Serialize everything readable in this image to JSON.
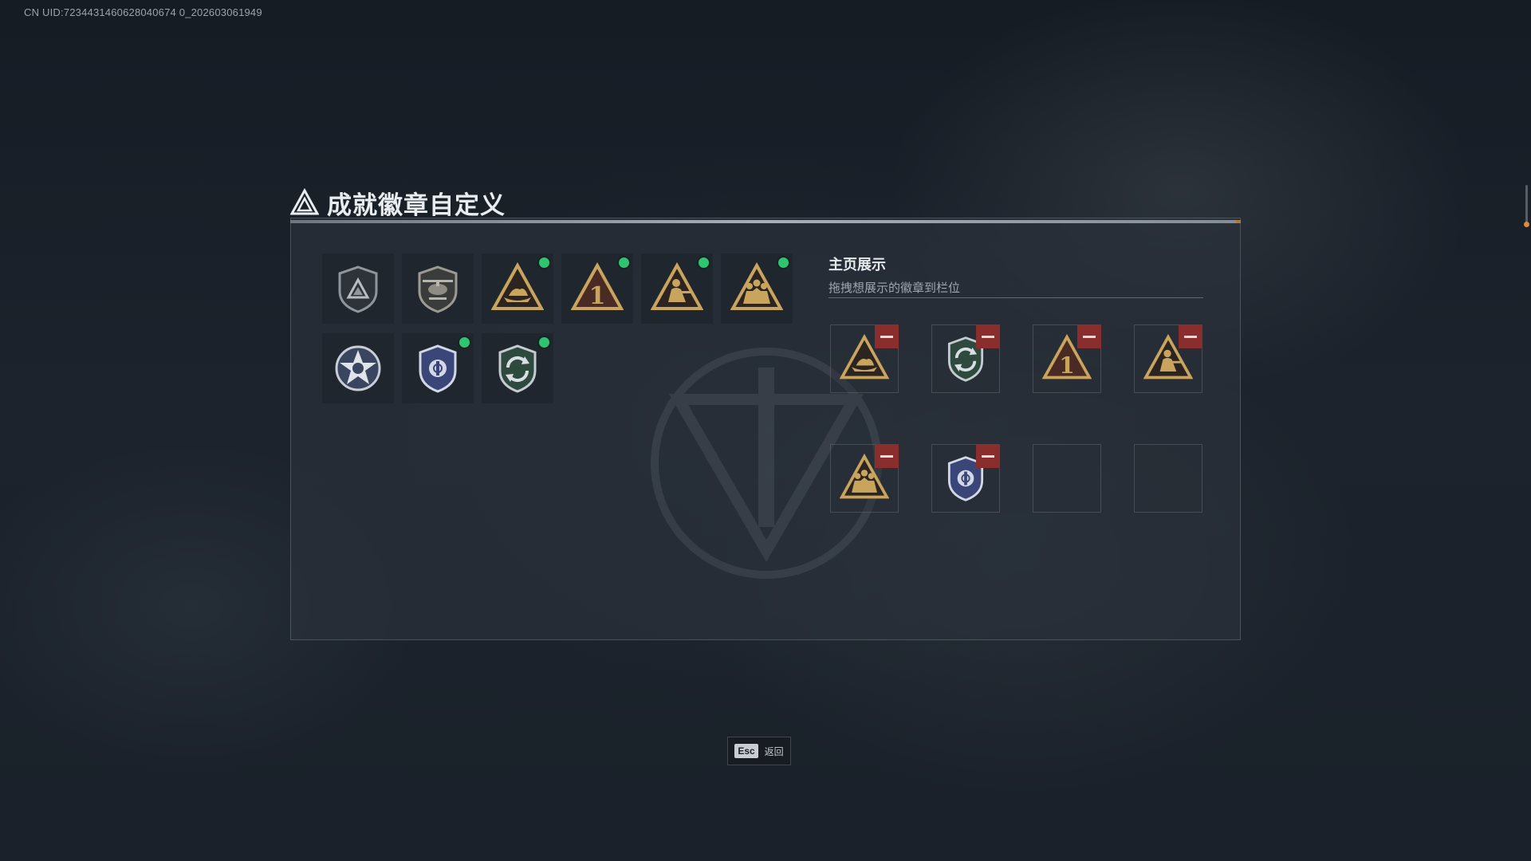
{
  "uid_text": "CN UID:7234431460628040674 0_202603061949",
  "title": "成就徽章自定义",
  "showcase": {
    "title": "主页展示",
    "subtitle": "拖拽想展示的徽章到栏位"
  },
  "inventory_badges": [
    {
      "icon": "shield-triangle-badge-icon",
      "new": false
    },
    {
      "icon": "helicopter-shield-badge-icon",
      "new": false
    },
    {
      "icon": "boat-triangle-badge-icon",
      "new": true
    },
    {
      "icon": "number-one-triangle-badge-icon",
      "new": true
    },
    {
      "icon": "soldier-triangle-badge-icon",
      "new": true
    },
    {
      "icon": "squad-triangle-badge-icon",
      "new": true
    },
    {
      "icon": "star-medal-badge-icon",
      "new": false
    },
    {
      "icon": "police-shield-badge-icon",
      "new": true
    },
    {
      "icon": "green-recycle-shield-badge-icon",
      "new": true
    }
  ],
  "showcase_slots": [
    {
      "icon": "boat-triangle-badge-icon",
      "filled": true
    },
    {
      "icon": "green-recycle-shield-badge-icon",
      "filled": true
    },
    {
      "icon": "number-one-triangle-badge-icon",
      "filled": true
    },
    {
      "icon": "soldier-triangle-badge-icon",
      "filled": true
    },
    {
      "icon": "squad-triangle-badge-icon",
      "filled": true
    },
    {
      "icon": "police-shield-badge-icon",
      "filled": true
    },
    {
      "icon": "",
      "filled": false
    },
    {
      "icon": "",
      "filled": false
    }
  ],
  "footer": {
    "esc_key": "Esc",
    "esc_label": "返回"
  },
  "colors": {
    "new_indicator": "#2fc46f",
    "remove_button": "#8a2d2d",
    "accent_orange": "#d48a3a",
    "badge_gold": "#c9a45c"
  }
}
